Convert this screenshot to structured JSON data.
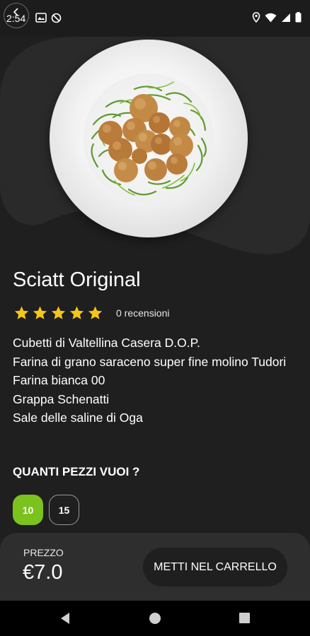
{
  "status_bar": {
    "time": "2:54",
    "left_icons": [
      "gallery-icon",
      "no-sync-icon"
    ],
    "right_icons": [
      "location-icon",
      "wifi-icon",
      "signal-icon",
      "battery-icon"
    ]
  },
  "product": {
    "title": "Sciatt Original",
    "rating_stars": 5,
    "star_color": "#f5c518",
    "reviews": "0 recensioni",
    "ingredients": [
      "Cubetti di Valtellina Casera D.O.P.",
      "Farina di grano saraceno super fine molino Tudori",
      "Farina bianca 00",
      "Grappa Schenatti",
      "Sale delle saline di Oga"
    ]
  },
  "quantity": {
    "label": "QUANTI PEZZI VUOI ?",
    "options": [
      "10",
      "15"
    ],
    "selected": "10",
    "accent_color": "#7cc21e"
  },
  "footer": {
    "price_label": "PREZZO",
    "price": "€7.0",
    "cart_button": "METTI NEL CARRELLO"
  },
  "nav": {
    "back": "nav-back-icon",
    "home": "nav-home-icon",
    "recents": "nav-recents-icon"
  }
}
